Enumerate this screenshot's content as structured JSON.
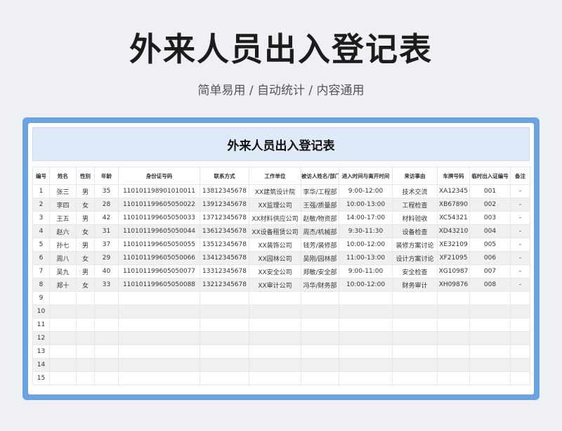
{
  "page": {
    "title": "外来人员出入登记表",
    "subtitle": "简单易用 / 自动统计 / 内容通用"
  },
  "sheet": {
    "title": "外来人员出入登记表",
    "columns": [
      "编号",
      "姓名",
      "性别",
      "年龄",
      "身份证号码",
      "联系方式",
      "工作单位",
      "被访人姓名/部门",
      "进入时间与离开时间",
      "来访事由",
      "车牌号码",
      "临时出入证编号",
      "备注"
    ],
    "rows": [
      [
        "1",
        "张三",
        "男",
        "35",
        "110101198901010011",
        "13812345678",
        "XX建筑设计院",
        "李华/工程部",
        "9:00-12:00",
        "技术交流",
        "XA12345",
        "001",
        "-"
      ],
      [
        "2",
        "李四",
        "女",
        "28",
        "110101199605050022",
        "13912345678",
        "XX监理公司",
        "王强/质量部",
        "10:00-13:00",
        "工程检查",
        "XB67890",
        "002",
        "-"
      ],
      [
        "3",
        "王五",
        "男",
        "42",
        "110101199605050033",
        "13712345678",
        "XX材料供应公司",
        "赵敏/物资部",
        "14:00-17:00",
        "材料验收",
        "XC54321",
        "003",
        "-"
      ],
      [
        "4",
        "赵六",
        "女",
        "31",
        "110101199605050044",
        "13612345678",
        "XX设备租赁公司",
        "周杰/机械部",
        "9:30-11:30",
        "设备检查",
        "XD43210",
        "004",
        "-"
      ],
      [
        "5",
        "孙七",
        "男",
        "37",
        "110101199605050055",
        "13512345678",
        "XX装饰公司",
        "钱芳/装修部",
        "10:00-12:00",
        "装修方案讨论",
        "XE32109",
        "005",
        "-"
      ],
      [
        "6",
        "周八",
        "女",
        "29",
        "110101199605050066",
        "13412345678",
        "XX园林公司",
        "吴刚/园林部",
        "11:00-13:00",
        "设计方案讨论",
        "XF21095",
        "006",
        "-"
      ],
      [
        "7",
        "吴九",
        "男",
        "40",
        "110101199605050077",
        "13312345678",
        "XX安全公司",
        "郑敏/安全部",
        "9:00-11:00",
        "安全检查",
        "XG10987",
        "007",
        "-"
      ],
      [
        "8",
        "郑十",
        "女",
        "33",
        "110101199605050088",
        "13212345678",
        "XX审计公司",
        "冯华/财务部",
        "10:00-12:00",
        "财务审计",
        "XH09876",
        "008",
        "-"
      ],
      [
        "9",
        "",
        "",
        "",
        "",
        "",
        "",
        "",
        "",
        "",
        "",
        "",
        ""
      ],
      [
        "10",
        "",
        "",
        "",
        "",
        "",
        "",
        "",
        "",
        "",
        "",
        "",
        ""
      ],
      [
        "11",
        "",
        "",
        "",
        "",
        "",
        "",
        "",
        "",
        "",
        "",
        "",
        ""
      ],
      [
        "12",
        "",
        "",
        "",
        "",
        "",
        "",
        "",
        "",
        "",
        "",
        "",
        ""
      ],
      [
        "13",
        "",
        "",
        "",
        "",
        "",
        "",
        "",
        "",
        "",
        "",
        "",
        ""
      ],
      [
        "14",
        "",
        "",
        "",
        "",
        "",
        "",
        "",
        "",
        "",
        "",
        "",
        ""
      ],
      [
        "15",
        "",
        "",
        "",
        "",
        "",
        "",
        "",
        "",
        "",
        "",
        "",
        ""
      ]
    ]
  }
}
